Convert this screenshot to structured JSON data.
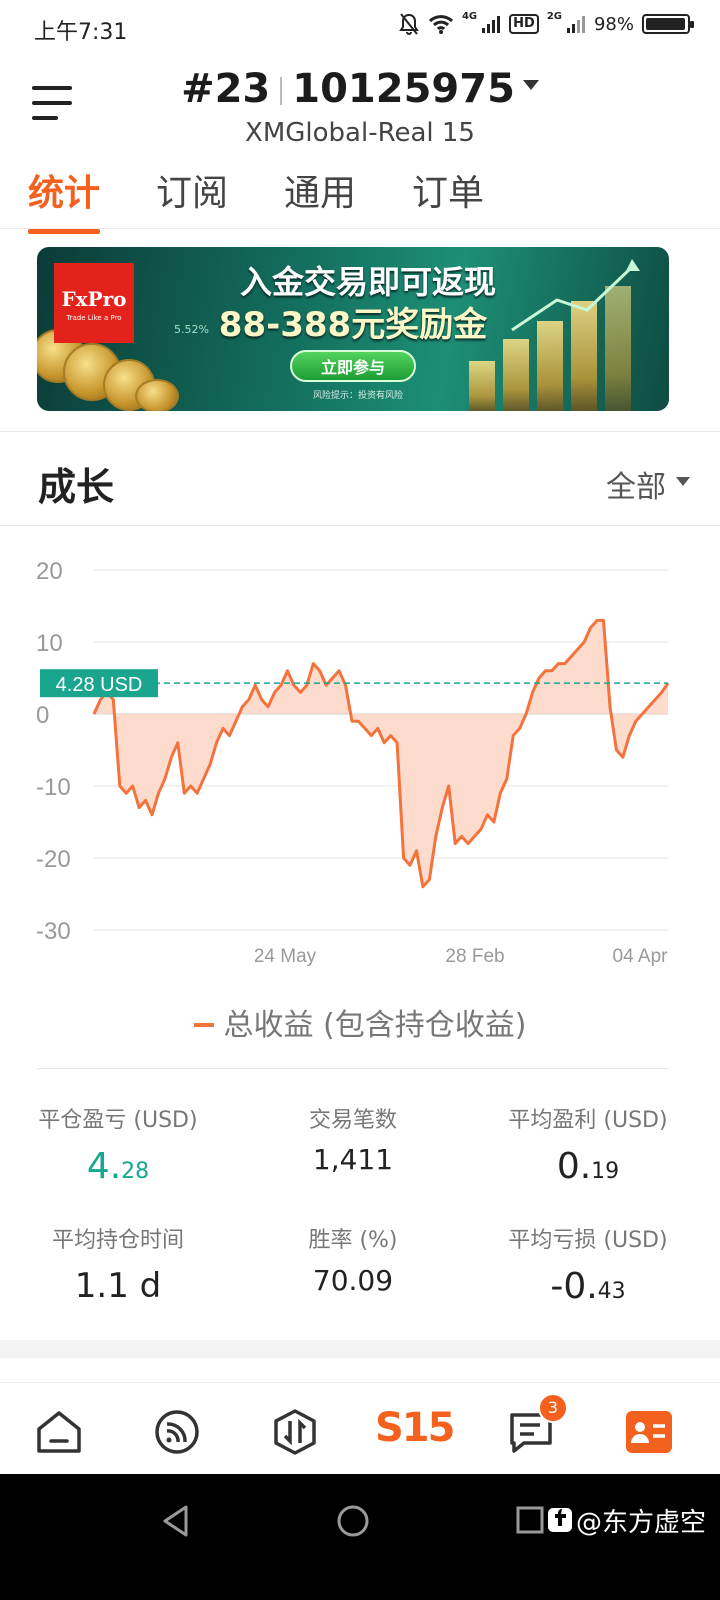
{
  "status_bar": {
    "time": "上午7:31",
    "net1": "4G",
    "hd": "HD",
    "net2": "2G",
    "battery": "98%"
  },
  "header": {
    "account_index": "#23",
    "account_number": "10125975",
    "server": "XMGlobal-Real 15"
  },
  "tabs": [
    {
      "label": "统计",
      "active": true
    },
    {
      "label": "订阅",
      "active": false
    },
    {
      "label": "通用",
      "active": false
    },
    {
      "label": "订单",
      "active": false
    }
  ],
  "banner": {
    "brand": "FxPro",
    "brand_tagline": "Trade Like a Pro",
    "headline": "入金交易即可返现",
    "subheadline": "88-388元奖励金",
    "cta": "立即参与",
    "risk_note": "风险提示：投资有风险",
    "pct": "5.52%"
  },
  "growth": {
    "title": "成长",
    "filter": "全部",
    "legend": "总收益 (包含持仓收益)"
  },
  "chart_data": {
    "type": "area",
    "ylim": [
      -30,
      20
    ],
    "yticks": [
      "20",
      "10",
      "0",
      "-10",
      "-20",
      "-30"
    ],
    "xtick_labels": [
      "24 May",
      "28 Feb",
      "04 Apr"
    ],
    "current_label": "4.28 USD",
    "current_value": 4.28,
    "grid": true,
    "colors": {
      "line": "#f4733d",
      "fill": "#fcd3c2",
      "marker": "#1aa58e"
    },
    "series": [
      {
        "name": "总收益 (包含持仓收益)",
        "values": [
          0,
          2,
          3,
          2,
          -10,
          -11,
          -10,
          -13,
          -12,
          -14,
          -11,
          -9,
          -6,
          -4,
          -11,
          -10,
          -11,
          -9,
          -7,
          -4,
          -2,
          -3,
          -1,
          1,
          2,
          4,
          2,
          1,
          3,
          4,
          6,
          4,
          3,
          4,
          7,
          6,
          4,
          5,
          6,
          4,
          -1,
          -1,
          -2,
          -3,
          -2,
          -4,
          -3,
          -4,
          -20,
          -21,
          -19,
          -24,
          -23,
          -17,
          -13,
          -10,
          -18,
          -17,
          -18,
          -17,
          -16,
          -14,
          -15,
          -11,
          -9,
          -3,
          -2,
          0,
          3,
          5,
          6,
          6,
          7,
          7,
          8,
          9,
          10,
          12,
          13,
          13,
          1,
          -5,
          -6,
          -3,
          -1,
          0,
          1,
          2,
          3,
          4.28
        ]
      }
    ]
  },
  "stats": [
    {
      "label": "平仓盈亏 (USD)",
      "int": "4.",
      "dec": "28",
      "highlight": true
    },
    {
      "label": "交易笔数",
      "value": "1,411"
    },
    {
      "label": "平均盈利 (USD)",
      "int": "0.",
      "dec": "19"
    },
    {
      "label": "平均持仓时间",
      "value": "1.1 d"
    },
    {
      "label": "胜率 (%)",
      "value": "70.09"
    },
    {
      "label": "平均亏损 (USD)",
      "int": "-0.",
      "dec": "43"
    }
  ],
  "bottom_nav": {
    "brand_label": "S15",
    "messages_badge": "3"
  },
  "watermark": "@东方虚空"
}
